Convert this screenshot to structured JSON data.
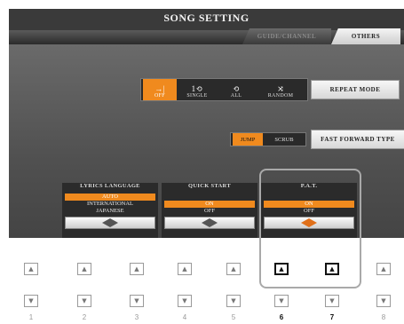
{
  "header": {
    "title": "SONG SETTING"
  },
  "tabs": [
    {
      "label": "GUIDE/CHANNEL",
      "active": false
    },
    {
      "label": "OTHERS",
      "active": true
    }
  ],
  "repeat_mode": {
    "label": "REPEAT MODE",
    "options": [
      {
        "label": "OFF",
        "icon": "→|",
        "selected": true
      },
      {
        "label": "SINGLE",
        "icon": "1⟲",
        "selected": false
      },
      {
        "label": "ALL",
        "icon": "⟲",
        "selected": false
      },
      {
        "label": "RANDOM",
        "icon": "⤨",
        "selected": false
      }
    ]
  },
  "fast_forward": {
    "label": "FAST FORWARD TYPE",
    "options": [
      {
        "label": "JUMP",
        "selected": true
      },
      {
        "label": "SCRUB",
        "selected": false
      }
    ]
  },
  "panels": {
    "lyrics": {
      "title": "LYRICS LANGUAGE",
      "options": [
        "AUTO",
        "INTERNATIONAL",
        "JAPANESE"
      ],
      "selected": "AUTO"
    },
    "quick_start": {
      "title": "QUICK START",
      "options": [
        "ON",
        "OFF"
      ],
      "selected": "ON"
    },
    "pat": {
      "title": "P.A.T.",
      "options": [
        "ON",
        "OFF"
      ],
      "selected": "ON"
    }
  },
  "hardware_buttons": {
    "numbers": [
      "1",
      "2",
      "3",
      "4",
      "5",
      "6",
      "7",
      "8"
    ],
    "active": [
      "6",
      "7"
    ],
    "up_glyph": "▲",
    "down_glyph": "▼"
  },
  "colors": {
    "accent": "#f08a1e",
    "screen_bg": "#3a3a3a",
    "frame": "#a9a9a9"
  }
}
